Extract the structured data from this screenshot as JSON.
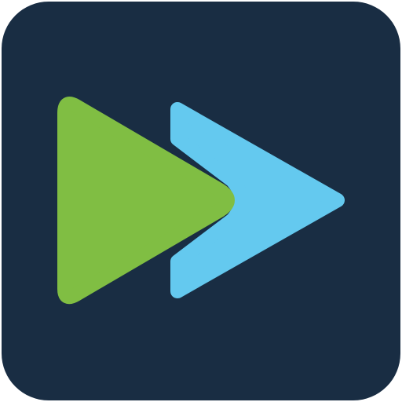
{
  "icon": {
    "name": "fast-forward-app-icon",
    "colors": {
      "background": "#192d43",
      "front_triangle": "#80be43",
      "back_chevron": "#64c9ef"
    }
  }
}
